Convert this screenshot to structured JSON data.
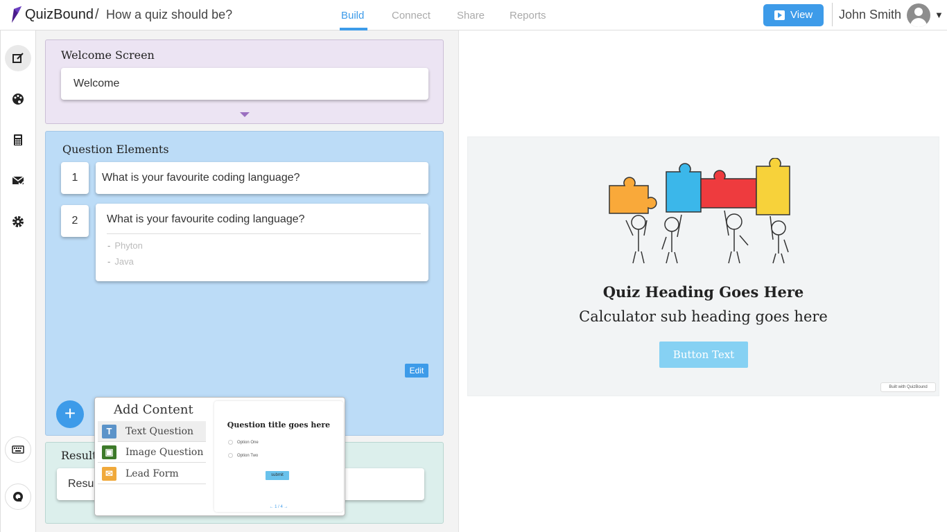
{
  "header": {
    "brand": "QuizBound",
    "separator": "/",
    "quiz_title": "How a quiz should be?",
    "tabs": [
      {
        "label": "Build",
        "active": true
      },
      {
        "label": "Connect",
        "active": false
      },
      {
        "label": "Share",
        "active": false
      },
      {
        "label": "Reports",
        "active": false
      }
    ],
    "view_label": "View",
    "user_name": "John Smith",
    "accent_color": "#3d9be9"
  },
  "sidebar": {
    "icons": [
      "edit-icon",
      "palette-icon",
      "calculator-icon",
      "mail-check-icon",
      "gear-icon",
      "keyboard-icon",
      "support-icon"
    ]
  },
  "welcome": {
    "title": "Welcome Screen",
    "card_text": "Welcome"
  },
  "questions": {
    "title": "Question Elements",
    "items": [
      {
        "number": "1",
        "text": "What is your favourite coding language?"
      },
      {
        "number": "2",
        "text": "What is your favourite coding language?",
        "options": [
          "Phyton",
          "Java"
        ]
      }
    ],
    "edit_label": "Edit",
    "add_label": "+"
  },
  "results": {
    "title": "Result",
    "card_text": "Resul"
  },
  "add_content": {
    "title": "Add Content",
    "items": [
      {
        "icon": "T",
        "label": "Text Question"
      },
      {
        "icon": "image-icon",
        "label": "Image Question"
      },
      {
        "icon": "mail-icon",
        "label": "Lead Form"
      }
    ],
    "preview": {
      "title": "Question title goes here",
      "options": [
        "Option One",
        "Option Two"
      ],
      "submit": "submit",
      "pager": "← 1 / 4 →"
    }
  },
  "quiz_preview": {
    "heading": "Quiz Heading Goes Here",
    "subheading": "Calculator sub heading goes here",
    "button": "Button Text",
    "built_with": "Built with QuizBound"
  }
}
